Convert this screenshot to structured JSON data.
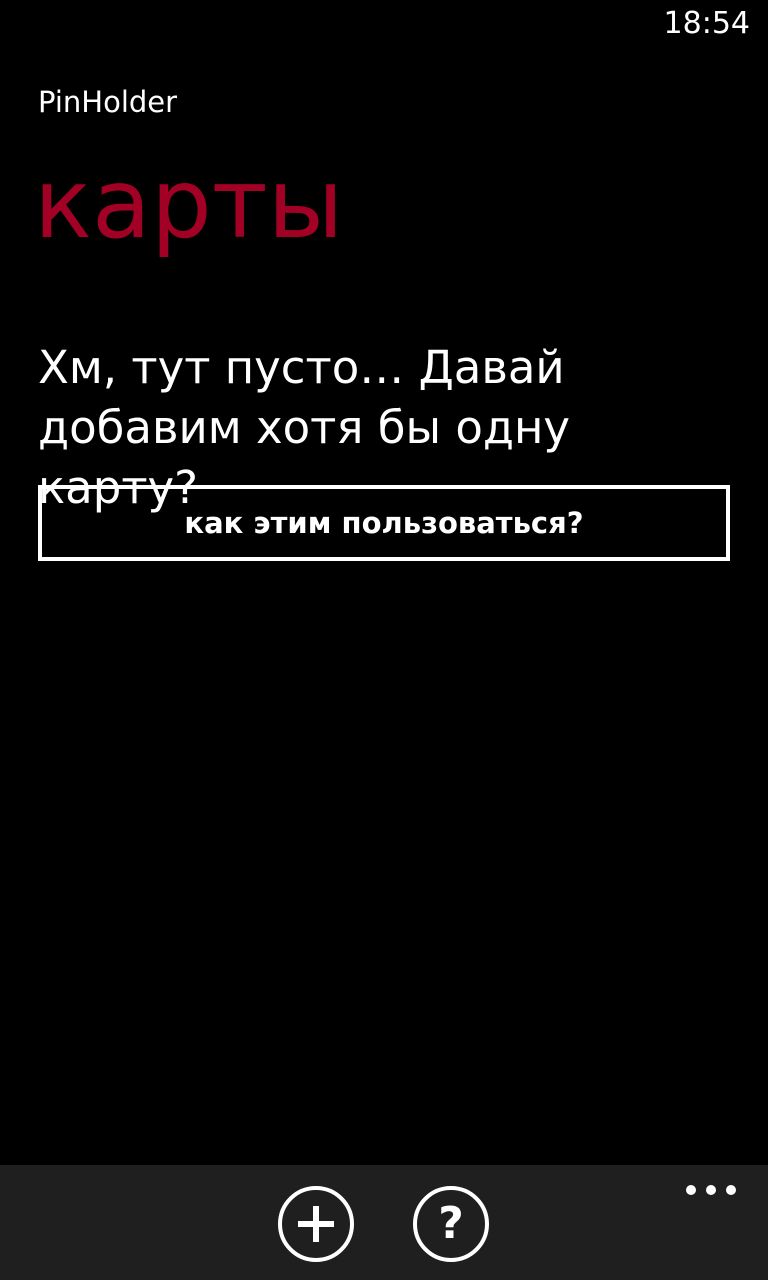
{
  "status_bar": {
    "time": "18:54"
  },
  "header": {
    "app_name": "PinHolder",
    "page_title": "карты"
  },
  "main": {
    "empty_message": "Хм, тут пусто… Давай добавим хотя бы одну карту?",
    "help_button_label": "как этим пользоваться?"
  },
  "app_bar": {
    "buttons": [
      {
        "icon": "plus-icon"
      },
      {
        "icon": "question-icon",
        "glyph": "?"
      }
    ],
    "more_icon": "ellipsis-icon"
  },
  "colors": {
    "accent": "#a20025",
    "background": "#000000",
    "app_bar": "#1f1f1f",
    "foreground": "#ffffff"
  }
}
